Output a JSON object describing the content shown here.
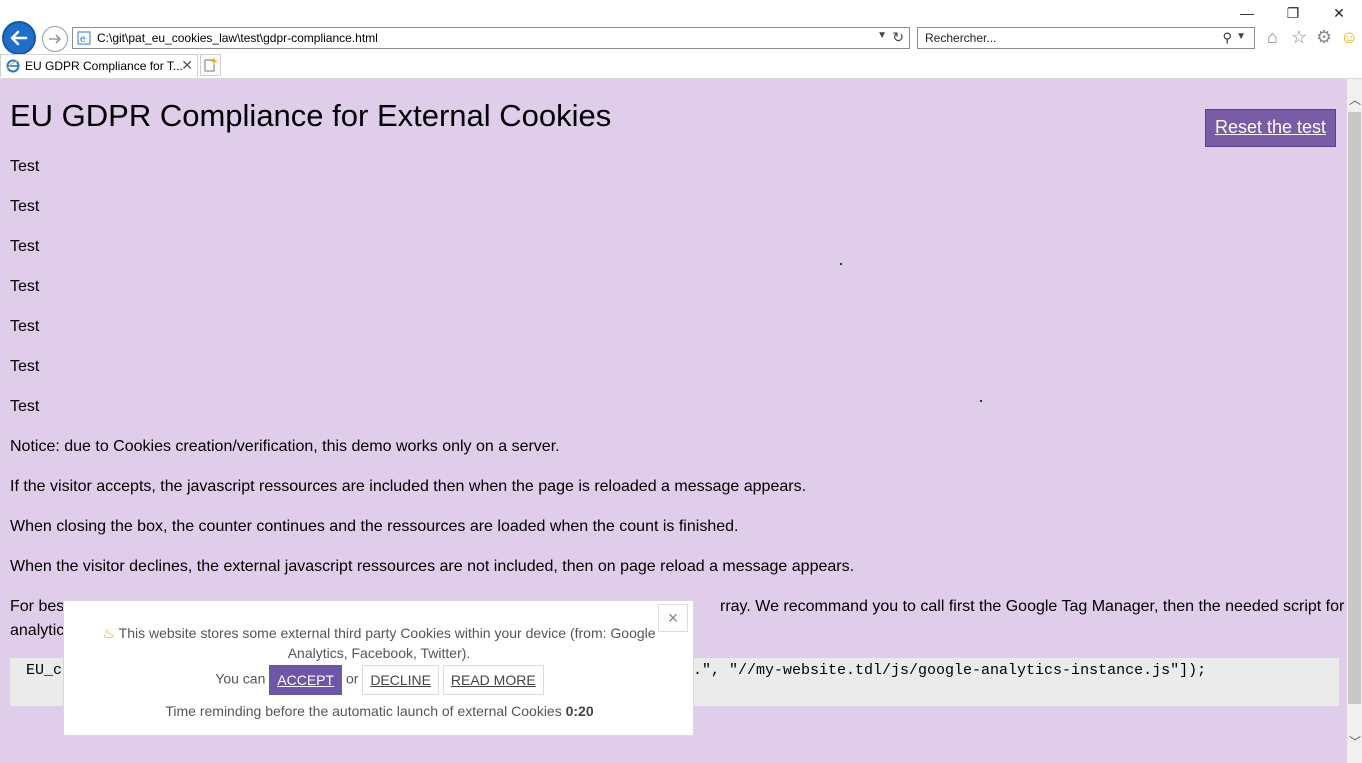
{
  "browser": {
    "url": "C:\\git\\pat_eu_cookies_law\\test\\gdpr-compliance.html",
    "search_placeholder": "Rechercher...",
    "tab_title": "EU GDPR Compliance for T...",
    "window_controls": [
      "—",
      "❐",
      "✕"
    ]
  },
  "page": {
    "title": "EU GDPR Compliance for External Cookies",
    "reset_label": "Reset the test",
    "tests": [
      "Test",
      "Test",
      "Test",
      "Test",
      "Test",
      "Test",
      "Test"
    ],
    "notice": "Notice: due to Cookies creation/verification, this demo works only on a server.",
    "para_accept": "If the visitor accepts, the javascript ressources are included then when the page is reloaded a message appears.",
    "para_closing": "When closing the box, the counter continues and the ressources are loaded when the count is finished.",
    "para_decline": "When the visitor declines, the external javascript ressources are not included, then on page reload a message appears.",
    "para_best_start": "For bes",
    "para_best_end": "rray. We recommand you to call first the Google Tag Manager, then the needed script for",
    "para_best_line2": "analytic",
    "code_start": "EU_c",
    "code_end": ".\", \"//my-website.tdl/js/google-analytics-instance.js\"]);"
  },
  "cookie_banner": {
    "close_label": "×",
    "message": "This website stores some external third party Cookies within your device (from: Google Analytics, Facebook, Twitter).",
    "you_can": "You can",
    "accept_label": "ACCEPT",
    "or": "or",
    "decline_label": "DECLINE",
    "read_more_label": "READ MORE",
    "timer_text": "Time reminding before the automatic launch of external Cookies",
    "timer_value": "0:20"
  },
  "colors": {
    "page_bg": "#e0cdea",
    "accent": "#7a5ca6",
    "accept_bg": "#6c56a5",
    "code_bg": "#ebebeb"
  }
}
